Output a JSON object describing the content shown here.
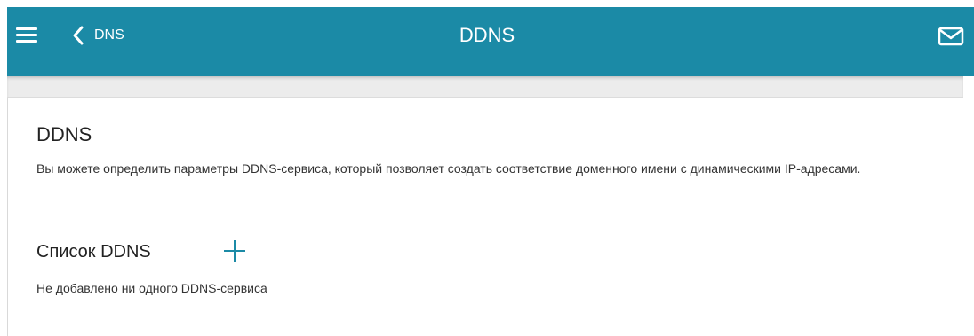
{
  "header": {
    "back_label": "DNS",
    "title": "DDNS",
    "background_color": "#1b8aa6",
    "icons": {
      "menu": "hamburger-menu-icon",
      "back": "chevron-left-icon",
      "messages": "mail-icon"
    }
  },
  "main": {
    "section_title": "DDNS",
    "description": "Вы можете определить параметры DDNS-сервиса, который позволяет создать соответствие доменного имени с динамическими IP-адресами.",
    "list": {
      "title": "Список DDNS",
      "add_icon": "plus-icon",
      "empty_message": "Не добавлено ни одного DDNS-сервиса"
    }
  },
  "colors": {
    "accent": "#1b8aa6",
    "subbar": "#ececec",
    "text": "#333333"
  }
}
